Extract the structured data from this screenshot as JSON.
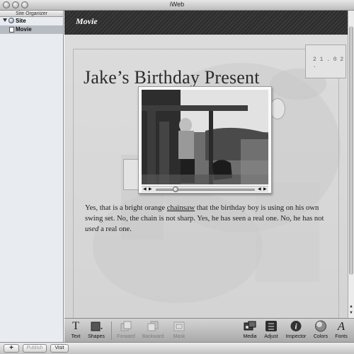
{
  "window": {
    "title": "iWeb"
  },
  "sidebar": {
    "header": "Site Organizer",
    "site_label": "Site",
    "page_label": "Movie"
  },
  "bottom_bar": {
    "add_label": "+",
    "publish_label": "Publish",
    "visit_label": "Visit"
  },
  "page": {
    "banner_title": "Movie",
    "heading": "Jake’s Birthday Present",
    "paragraph": {
      "part1": "Yes, that is a bright orange ",
      "underlined": "chainsaw",
      "part2": " that the birthday boy is using on his own swing set. No, the chain is not sharp. Yes, he has seen a real one. No, he has not ",
      "emphasis": "used",
      "part3": " a real one."
    },
    "stamp_text": "2 1 . 0 2 .",
    "video": {
      "progress": 0.18
    }
  },
  "toolbar": {
    "text": "Text",
    "shapes": "Shapes",
    "forward": "Forward",
    "backward": "Backward",
    "mask": "Mask",
    "media": "Media",
    "adjust": "Adjust",
    "inspector": "Inspector",
    "colors": "Colors",
    "fonts": "Fonts"
  },
  "icons": {
    "text": "text-icon",
    "shapes": "shapes-icon",
    "forward": "bring-forward-icon",
    "backward": "send-backward-icon",
    "mask": "mask-icon",
    "media": "media-icon",
    "adjust": "adjust-icon",
    "inspector": "info-icon",
    "colors": "color-wheel-icon",
    "fonts": "fonts-icon"
  }
}
